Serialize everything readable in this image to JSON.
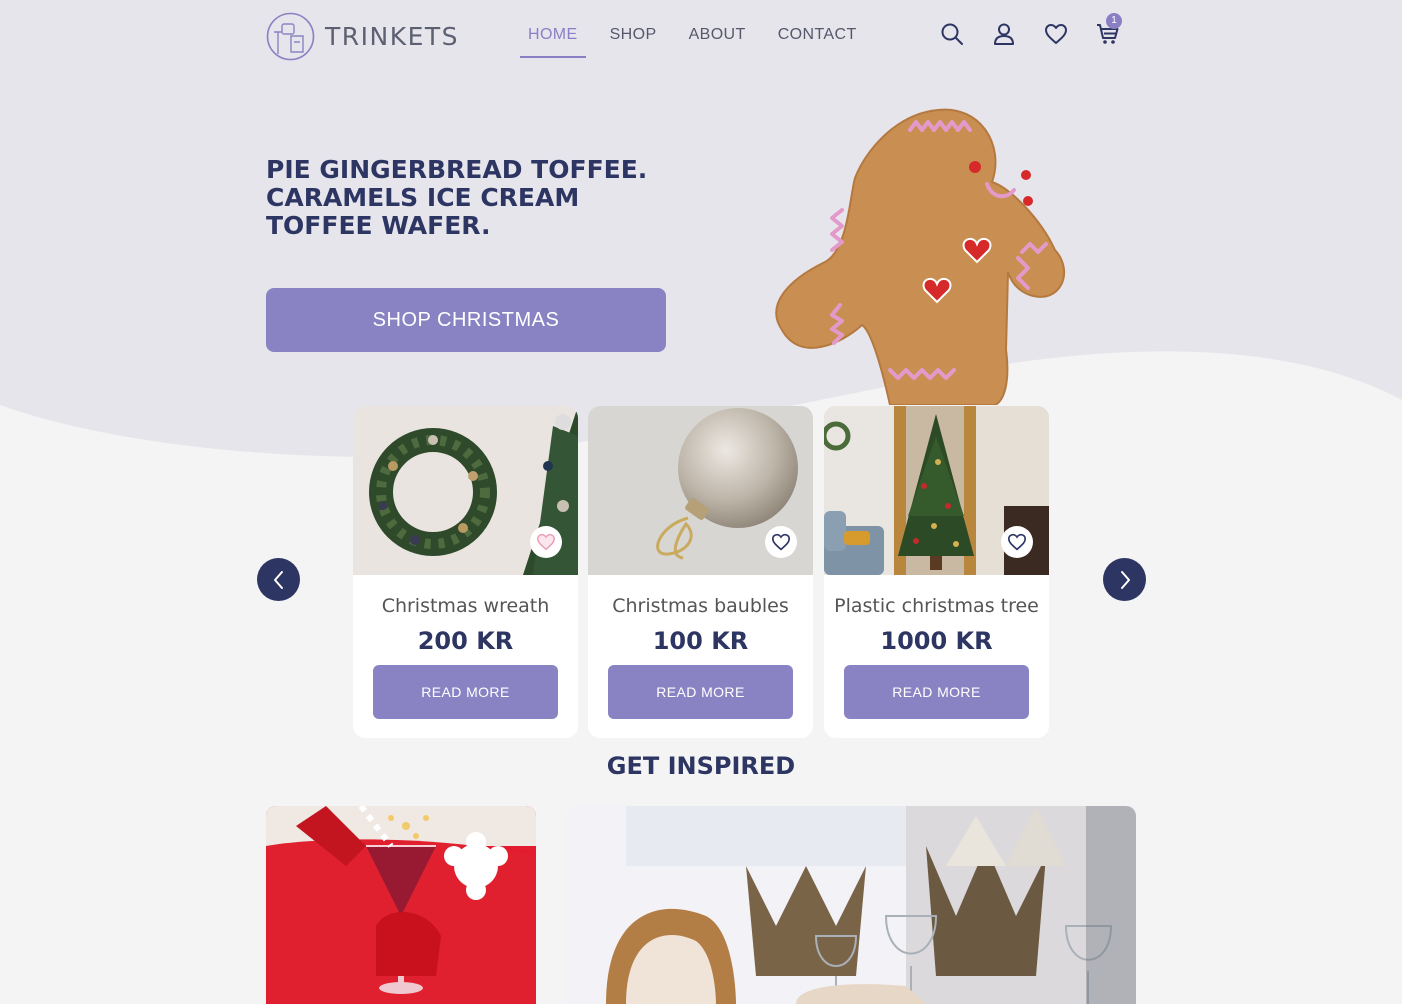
{
  "brand": {
    "name": "TRINKETS",
    "accent": "#8a83c3",
    "navy": "#2d3563"
  },
  "nav": {
    "items": [
      {
        "label": "HOME",
        "active": true
      },
      {
        "label": "SHOP",
        "active": false
      },
      {
        "label": "ABOUT",
        "active": false
      },
      {
        "label": "CONTACT",
        "active": false
      }
    ]
  },
  "header_icons": [
    "search-icon",
    "user-icon",
    "heart-icon",
    "cart-icon"
  ],
  "cart": {
    "count": "1"
  },
  "hero": {
    "title": "PIE GINGERBREAD TOFFEE. CARAMELS ICE CREAM TOFFEE WAFER.",
    "button_label": "SHOP CHRISTMAS",
    "image": "gingerbread-man"
  },
  "products": [
    {
      "name": "Christmas wreath",
      "price": "200 KR",
      "button": "READ MORE",
      "favorited": true,
      "image": "wreath"
    },
    {
      "name": "Christmas baubles",
      "price": "100 KR",
      "button": "READ MORE",
      "favorited": false,
      "image": "bauble"
    },
    {
      "name": "Plastic christmas tree",
      "price": "1000 KR",
      "button": "READ MORE",
      "favorited": false,
      "image": "tree"
    }
  ],
  "inspired": {
    "title": "GET INSPIRED",
    "images": [
      "red-cocktail",
      "dinner-table"
    ]
  }
}
